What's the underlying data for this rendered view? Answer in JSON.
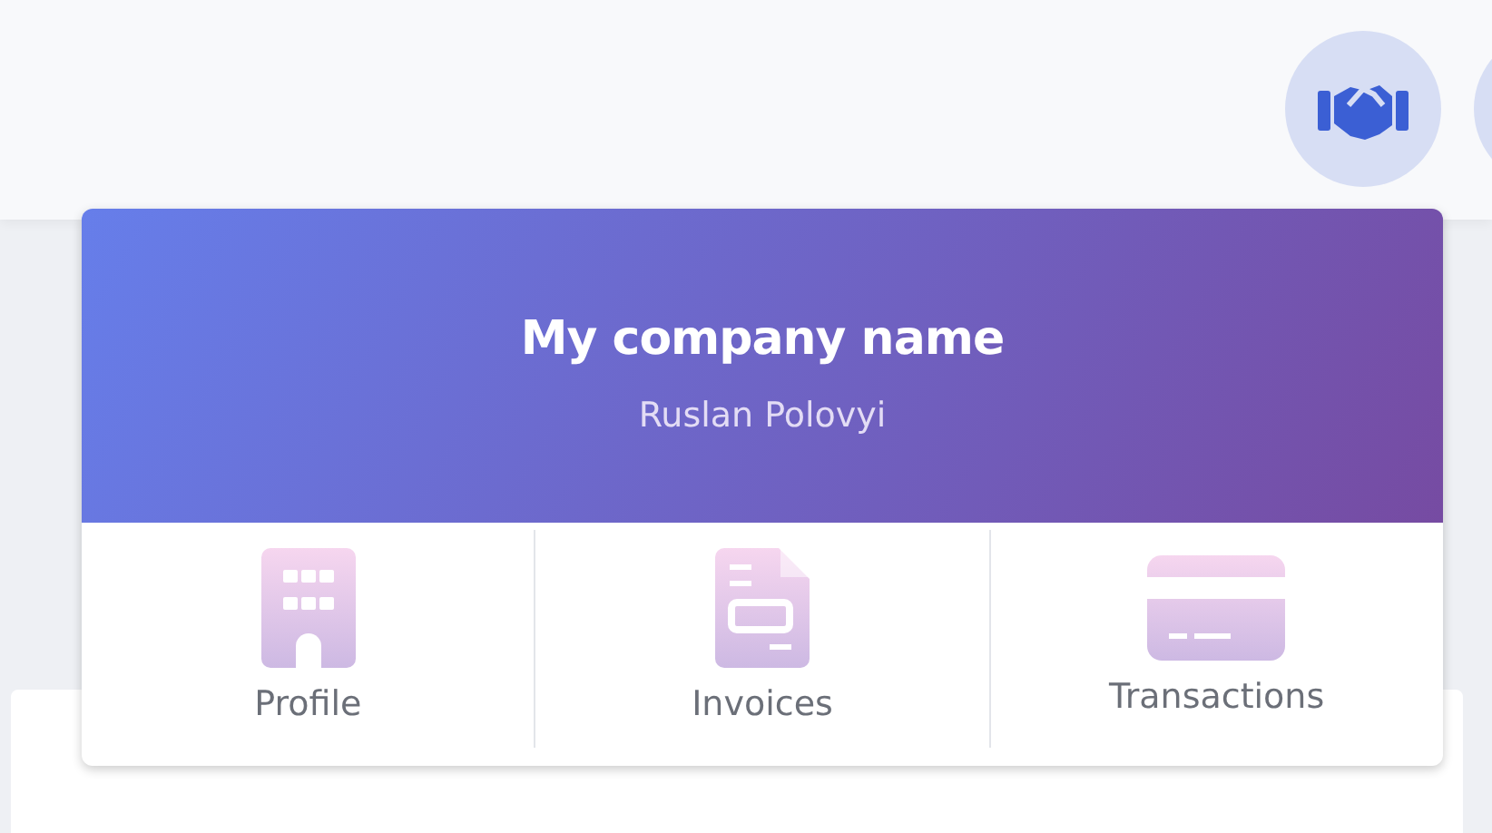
{
  "dropdown": {
    "title": "My company name",
    "subtitle": "Ruslan Polovyi",
    "items": [
      {
        "label": "Profile",
        "kind": "building"
      },
      {
        "label": "Invoices",
        "kind": "invoice"
      },
      {
        "label": "Transactions",
        "kind": "card"
      }
    ]
  }
}
